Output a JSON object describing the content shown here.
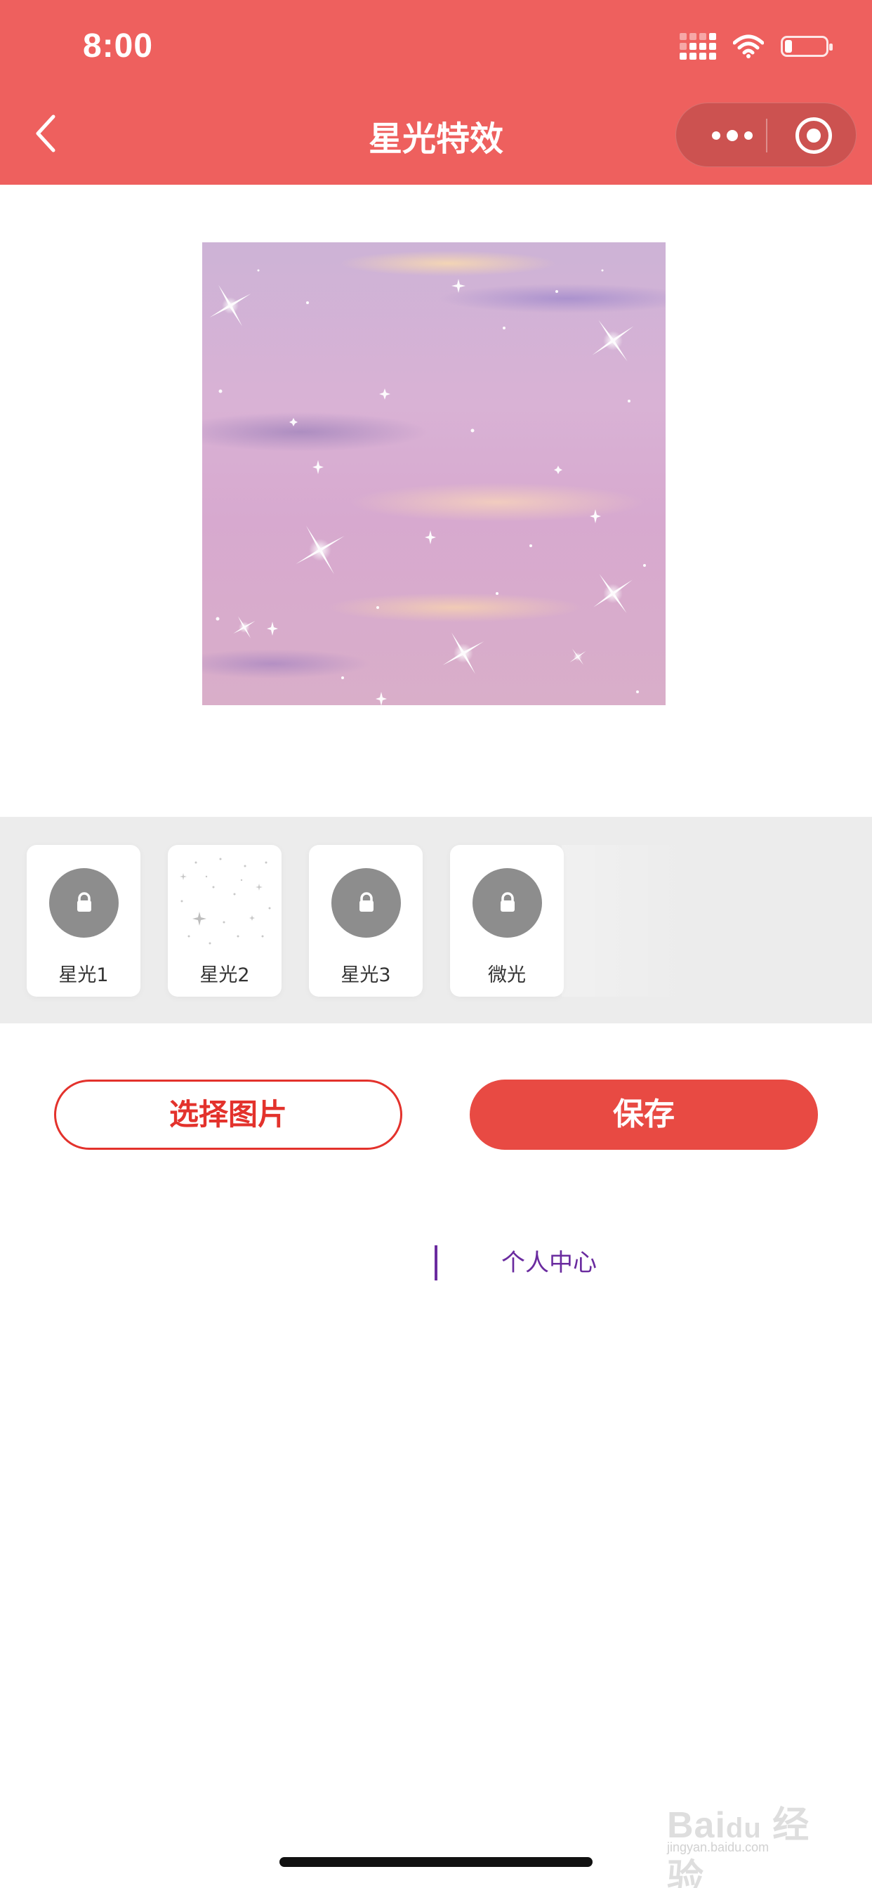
{
  "status_bar": {
    "time": "8:00"
  },
  "nav": {
    "title": "星光特效",
    "back_icon": "chevron-left-icon",
    "more_icon": "more-dots-icon",
    "close_icon": "target-circle-icon"
  },
  "effects": [
    {
      "label": "星光1",
      "locked": true
    },
    {
      "label": "星光2",
      "locked": false
    },
    {
      "label": "星光3",
      "locked": true
    },
    {
      "label": "微光",
      "locked": true
    }
  ],
  "actions": {
    "select_label": "选择图片",
    "save_label": "保存"
  },
  "footer_link": {
    "label": "个人中心"
  },
  "watermark": {
    "text": "Bai 经验",
    "sub": "jingyan.baidu.com"
  },
  "colors": {
    "header": "#ee605e",
    "accent": "#e84a43",
    "link": "#6a2b9f"
  }
}
